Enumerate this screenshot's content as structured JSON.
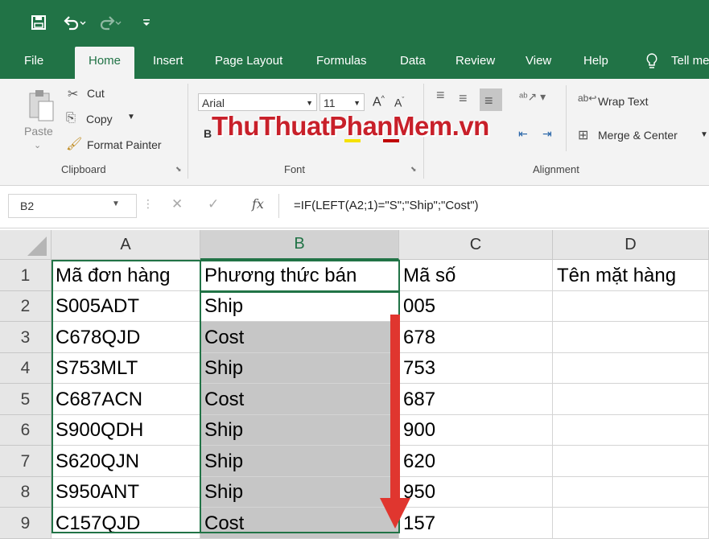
{
  "quick_access": {
    "save_icon": "save-icon",
    "undo_icon": "undo-icon",
    "redo_icon": "redo-icon",
    "customize_icon": "customize-icon"
  },
  "tabs": [
    "File",
    "Home",
    "Insert",
    "Page Layout",
    "Formulas",
    "Data",
    "Review",
    "View",
    "Help"
  ],
  "tell_me": "Tell me",
  "clipboard": {
    "paste": "Paste",
    "cut": "Cut",
    "copy": "Copy",
    "format_painter": "Format Painter",
    "label": "Clipboard"
  },
  "font": {
    "name": "Arial",
    "size": "11",
    "bold": "B",
    "label": "Font"
  },
  "alignment": {
    "wrap_text": "Wrap Text",
    "merge_center": "Merge & Center",
    "label": "Alignment"
  },
  "watermark": "ThuThuatPhanMem.vn",
  "formula_bar": {
    "name_box": "B2",
    "fx": "fx",
    "formula": "=IF(LEFT(A2;1)=\"S\";\"Ship\";\"Cost\")"
  },
  "columns": [
    "A",
    "B",
    "C",
    "D"
  ],
  "rows": [
    {
      "num": "1",
      "a": "Mã đơn hàng",
      "b": "Phương thức bán",
      "c": "Mã số",
      "d": "Tên mặt hàng"
    },
    {
      "num": "2",
      "a": "S005ADT",
      "b": "Ship",
      "c": "005",
      "d": ""
    },
    {
      "num": "3",
      "a": "C678QJD",
      "b": "Cost",
      "c": "678",
      "d": ""
    },
    {
      "num": "4",
      "a": "S753MLT",
      "b": "Ship",
      "c": "753",
      "d": ""
    },
    {
      "num": "5",
      "a": "C687ACN",
      "b": "Cost",
      "c": "687",
      "d": ""
    },
    {
      "num": "6",
      "a": "S900QDH",
      "b": "Ship",
      "c": "900",
      "d": ""
    },
    {
      "num": "7",
      "a": "S620QJN",
      "b": "Ship",
      "c": "620",
      "d": ""
    },
    {
      "num": "8",
      "a": "S950ANT",
      "b": "Ship",
      "c": "950",
      "d": ""
    },
    {
      "num": "9",
      "a": "C157QJD",
      "b": "Cost",
      "c": "157",
      "d": ""
    }
  ],
  "colors": {
    "excel_green": "#217346",
    "arrow_red": "#e0362f",
    "watermark_red": "#c8202a",
    "selection_gray": "#c6c6c6"
  }
}
